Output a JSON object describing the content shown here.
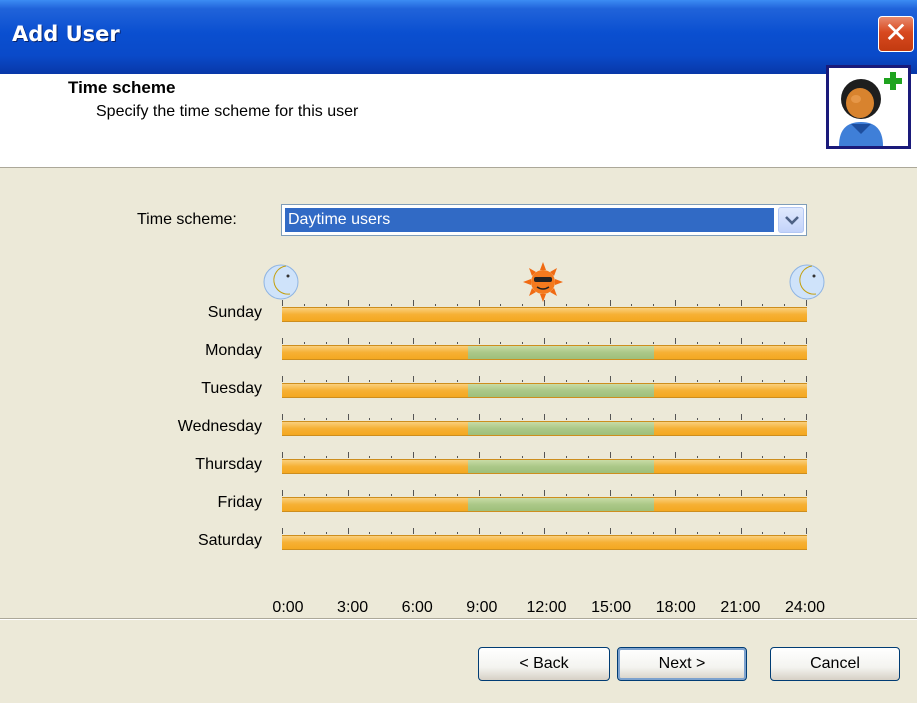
{
  "window": {
    "title": "Add User",
    "close_glyph": "✕"
  },
  "header": {
    "title": "Time scheme",
    "subtitle": "Specify the time scheme for this user",
    "icon": "add-user-icon"
  },
  "time_scheme": {
    "label": "Time scheme:",
    "selected": "Daytime users",
    "arrow_icon": "chevron-down-icon"
  },
  "schedule": {
    "icons": [
      "moon-icon",
      "sun-icon",
      "moon-icon"
    ],
    "days": [
      {
        "name": "Sunday",
        "segments": [
          {
            "from": 0,
            "to": 24,
            "state": "orange"
          }
        ]
      },
      {
        "name": "Monday",
        "segments": [
          {
            "from": 0,
            "to": 8.5,
            "state": "orange"
          },
          {
            "from": 8.5,
            "to": 17,
            "state": "green"
          },
          {
            "from": 17,
            "to": 24,
            "state": "orange"
          }
        ]
      },
      {
        "name": "Tuesday",
        "segments": [
          {
            "from": 0,
            "to": 8.5,
            "state": "orange"
          },
          {
            "from": 8.5,
            "to": 17,
            "state": "green"
          },
          {
            "from": 17,
            "to": 24,
            "state": "orange"
          }
        ]
      },
      {
        "name": "Wednesday",
        "segments": [
          {
            "from": 0,
            "to": 8.5,
            "state": "orange"
          },
          {
            "from": 8.5,
            "to": 17,
            "state": "green"
          },
          {
            "from": 17,
            "to": 24,
            "state": "orange"
          }
        ]
      },
      {
        "name": "Thursday",
        "segments": [
          {
            "from": 0,
            "to": 8.5,
            "state": "orange"
          },
          {
            "from": 8.5,
            "to": 17,
            "state": "green"
          },
          {
            "from": 17,
            "to": 24,
            "state": "orange"
          }
        ]
      },
      {
        "name": "Friday",
        "segments": [
          {
            "from": 0,
            "to": 8.5,
            "state": "orange"
          },
          {
            "from": 8.5,
            "to": 17,
            "state": "green"
          },
          {
            "from": 17,
            "to": 24,
            "state": "orange"
          }
        ]
      },
      {
        "name": "Saturday",
        "segments": [
          {
            "from": 0,
            "to": 24,
            "state": "orange"
          }
        ]
      }
    ],
    "hours": [
      "0:00",
      "3:00",
      "6:00",
      "9:00",
      "12:00",
      "15:00",
      "18:00",
      "21:00",
      "24:00"
    ],
    "colors": {
      "orange": "#F6B034",
      "green": "#ABC888"
    }
  },
  "footer": {
    "back_label": "< Back",
    "next_label": "Next >",
    "cancel_label": "Cancel"
  }
}
